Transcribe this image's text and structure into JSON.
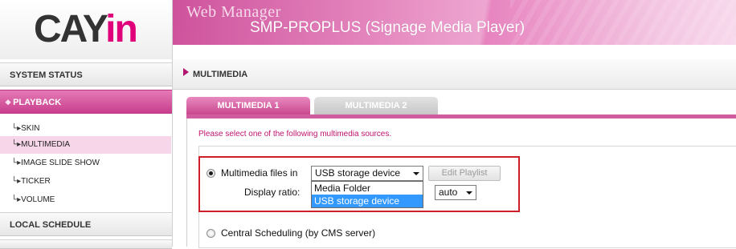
{
  "header": {
    "logo_prefix": "CAY",
    "logo_suffix": "in",
    "title": "Web Manager",
    "subtitle": "SMP-PROPLUS (Signage Media Player)"
  },
  "sidebar": {
    "system_status": "SYSTEM STATUS",
    "playback": "PLAYBACK",
    "items": [
      "SKIN",
      "MULTIMEDIA",
      "IMAGE SLIDE SHOW",
      "TICKER",
      "VOLUME"
    ],
    "local_schedule": "LOCAL SCHEDULE"
  },
  "breadcrumb": "MULTIMEDIA",
  "tabs": [
    "MULTIMEDIA 1",
    "MULTIMEDIA 2"
  ],
  "instruction": "Please select one of the following multimedia sources.",
  "form": {
    "multimedia_label": "Multimedia files in",
    "source_value": "USB storage device",
    "edit_playlist": "Edit Playlist",
    "ratio_label": "Display ratio:",
    "ratio_value": "auto",
    "options": [
      "Media Folder",
      "USB storage device"
    ],
    "central_label": "Central Scheduling (by CMS server)"
  },
  "colors": {
    "accent": "#c93f8d",
    "highlight_frame": "#cc1f27",
    "selected_option": "#3399ff"
  },
  "icons": {
    "breadcrumb": "triangle-right-icon",
    "section": "diamond-icon",
    "dropdown": "chevron-down-icon",
    "tree_branch": "branch-icon"
  }
}
